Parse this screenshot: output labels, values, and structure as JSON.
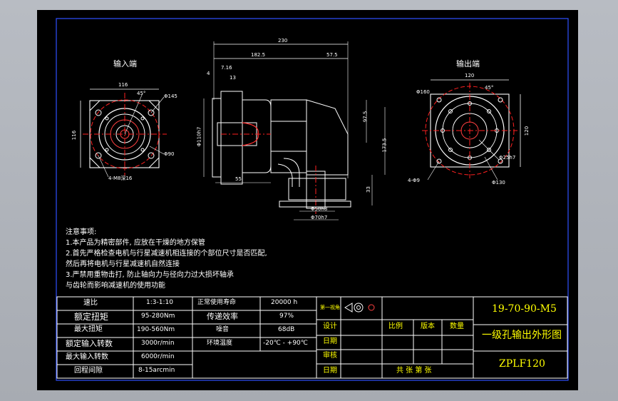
{
  "views": {
    "input_label": "输入端",
    "output_label": "输出端"
  },
  "input_dims": {
    "width": "116",
    "angle": "45°",
    "pcd": "Φ145",
    "height": "116",
    "bore": "Φ90",
    "holes": "4-M8深16"
  },
  "side_dims": {
    "overall": "230",
    "length1": "182.5",
    "length2": "57.5",
    "d1": "7.16",
    "d2": "4",
    "d3": "13",
    "shaft_dia": "Φ110h7",
    "bottom1": "55",
    "right1": "97.5",
    "right2": "173.5",
    "right3": "33",
    "bottom_dia1": "Φ50h8",
    "bottom_dia2": "Φ70h7"
  },
  "output_dims": {
    "width": "120",
    "pcd": "Φ160",
    "angle": "45°",
    "height": "120",
    "holes": "4-Φ9",
    "bore": "Φ25h7",
    "flange": "Φ130"
  },
  "notes": {
    "title": "注意事项:",
    "lines": [
      "1.本产品为精密部件, 应放在干燥的地方保管",
      "2.首先严格检查电机与行星减速机相连接的个部位尺寸是否匹配,",
      "然后再将电机与行星减速机自然连接",
      "3.严禁用重物击打, 防止轴向力与径向力过大损坏轴承",
      "与齿轮而影响减速机的使用功能"
    ]
  },
  "spec_table": {
    "rows": [
      [
        "速比",
        "1:3-1:10",
        "正常使用寿命",
        "20000 h"
      ],
      [
        "额定扭矩",
        "95-280Nm",
        "传递效率",
        "97%"
      ],
      [
        "最大扭矩",
        "190-560Nm",
        "噪音",
        "68dB"
      ],
      [
        "额定输入转数",
        "3000r/min",
        "环境温度",
        "-20℃ - +90℃"
      ],
      [
        "最大输入转数",
        "6000r/min",
        "",
        ""
      ],
      [
        "回程间隙",
        "8-15arcmin",
        "",
        ""
      ]
    ]
  },
  "title_block": {
    "projection": "第一视角",
    "design": "设计",
    "scale": "比例",
    "version": "版本",
    "quantity": "数量",
    "check": "审核",
    "date": "日期",
    "sheets": "共  张  第  张",
    "drawing_number": "19-70-90-M5",
    "drawing_title": "一级孔输出外形图",
    "model": "ZPLF120"
  }
}
